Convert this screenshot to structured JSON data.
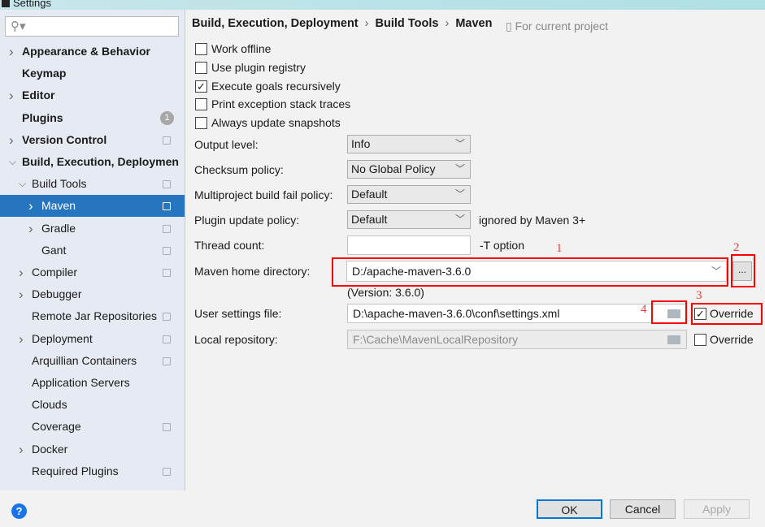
{
  "window": {
    "title": "Settings"
  },
  "search": {
    "placeholder": ""
  },
  "sidebar": {
    "items": [
      {
        "label": "Appearance & Behavior",
        "level": 0,
        "arrow": "collapsed",
        "bold": true
      },
      {
        "label": "Keymap",
        "level": 0,
        "bold": true
      },
      {
        "label": "Editor",
        "level": 0,
        "arrow": "collapsed",
        "bold": true
      },
      {
        "label": "Plugins",
        "level": 0,
        "bold": true,
        "badge": "1"
      },
      {
        "label": "Version Control",
        "level": 0,
        "arrow": "collapsed",
        "bold": true,
        "copy": true
      },
      {
        "label": "Build, Execution, Deploymen",
        "level": 0,
        "arrow": "expanded",
        "bold": true
      },
      {
        "label": "Build Tools",
        "level": 1,
        "arrow": "expanded",
        "copy": true
      },
      {
        "label": "Maven",
        "level": 2,
        "arrow": "collapsed",
        "copy": true,
        "selected": true
      },
      {
        "label": "Gradle",
        "level": 2,
        "arrow": "collapsed",
        "copy": true
      },
      {
        "label": "Gant",
        "level": 2,
        "copy": true
      },
      {
        "label": "Compiler",
        "level": 1,
        "arrow": "collapsed",
        "copy": true
      },
      {
        "label": "Debugger",
        "level": 1,
        "arrow": "collapsed"
      },
      {
        "label": "Remote Jar Repositories",
        "level": 1,
        "copy": true
      },
      {
        "label": "Deployment",
        "level": 1,
        "arrow": "collapsed",
        "copy": true
      },
      {
        "label": "Arquillian Containers",
        "level": 1,
        "copy": true
      },
      {
        "label": "Application Servers",
        "level": 1
      },
      {
        "label": "Clouds",
        "level": 1
      },
      {
        "label": "Coverage",
        "level": 1,
        "copy": true
      },
      {
        "label": "Docker",
        "level": 1,
        "arrow": "collapsed"
      },
      {
        "label": "Required Plugins",
        "level": 1,
        "copy": true
      }
    ]
  },
  "breadcrumb": {
    "items": [
      "Build, Execution, Deployment",
      "Build Tools",
      "Maven"
    ],
    "sep": "›",
    "scope": "For current project"
  },
  "checkboxes": [
    {
      "label": "Work offline",
      "checked": false
    },
    {
      "label": "Use plugin registry",
      "checked": false
    },
    {
      "label": "Execute goals recursively",
      "checked": true
    },
    {
      "label": "Print exception stack traces",
      "checked": false
    },
    {
      "label": "Always update snapshots",
      "checked": false
    }
  ],
  "form": {
    "output_level": {
      "label": "Output level:",
      "value": "Info"
    },
    "checksum": {
      "label": "Checksum policy:",
      "value": "No Global Policy"
    },
    "multiproject": {
      "label": "Multiproject build fail policy:",
      "value": "Default"
    },
    "plugin_update": {
      "label": "Plugin update policy:",
      "value": "Default",
      "note": "ignored by Maven 3+"
    },
    "thread_count": {
      "label": "Thread count:",
      "value": "",
      "note": "-T option"
    },
    "maven_home": {
      "label": "Maven home directory:",
      "value": "D:/apache-maven-3.6.0",
      "browse": "...",
      "version": "(Version: 3.6.0)"
    },
    "user_settings": {
      "label": "User settings file:",
      "value": "D:\\apache-maven-3.6.0\\conf\\settings.xml",
      "override_label": "Override",
      "override": true
    },
    "local_repo": {
      "label": "Local repository:",
      "value": "F:\\Cache\\MavenLocalRepository",
      "override_label": "Override",
      "override": false
    }
  },
  "annotations": [
    "1",
    "2",
    "3",
    "4"
  ],
  "footer": {
    "ok": "OK",
    "cancel": "Cancel",
    "apply": "Apply",
    "help": "?"
  },
  "colors": {
    "selection": "#2675bf",
    "annotation": "#ff0000",
    "ok_border": "#0078d7"
  }
}
